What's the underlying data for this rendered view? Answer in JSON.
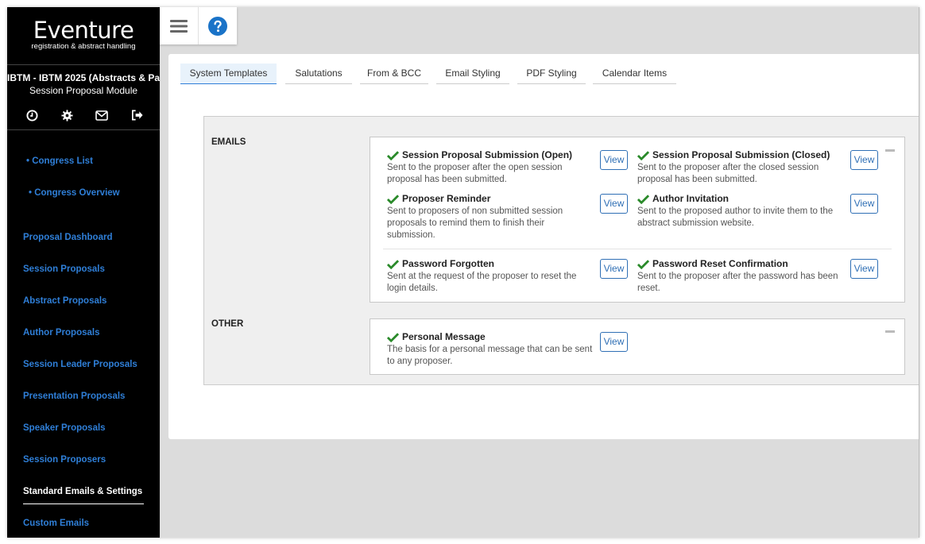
{
  "sidebar": {
    "logo_title": "Eventure",
    "logo_subtitle": "registration & abstract handling",
    "congress_title": "IBTM - IBTM 2025 (Abstracts & Par...",
    "module_title": "Session Proposal Module",
    "icons": [
      "clock-icon",
      "gear-icon",
      "mail-icon",
      "logout-icon"
    ],
    "sub_links": [
      "• Congress List",
      "• Congress Overview"
    ],
    "nav_items": [
      "Proposal Dashboard",
      "Session Proposals",
      "Abstract Proposals",
      "Author Proposals",
      "Session Leader Proposals",
      "Presentation Proposals",
      "Speaker Proposals",
      "Session Proposers",
      "Standard Emails & Settings",
      "Custom Emails"
    ],
    "active_item": "Standard Emails & Settings"
  },
  "toolbar": {
    "menu_icon": "hamburger-icon",
    "help_icon": "help-icon"
  },
  "tabs": [
    "System Templates",
    "Salutations",
    "From & BCC",
    "Email Styling",
    "PDF Styling",
    "Calendar Items"
  ],
  "active_tab": "System Templates",
  "sections": {
    "emails": {
      "label": "EMAILS",
      "templates": [
        {
          "title": "Session Proposal Submission (Open)",
          "desc": "Sent to the proposer after the open session proposal has been submitted.",
          "button": "View"
        },
        {
          "title": "Session Proposal Submission (Closed)",
          "desc": "Sent to the proposer after the closed session proposal has been submitted.",
          "button": "View"
        },
        {
          "title": "Proposer Reminder",
          "desc": "Sent to proposers of non submitted session proposals to remind them to finish their submission.",
          "button": "View"
        },
        {
          "title": "Author Invitation",
          "desc": "Sent to the proposed author to invite them to the abstract submission website.",
          "button": "View"
        },
        {
          "title": "Password Forgotten",
          "desc": "Sent at the request of the proposer to reset the login details.",
          "button": "View"
        },
        {
          "title": "Password Reset Confirmation",
          "desc": "Sent to the proposer after the password has been reset.",
          "button": "View"
        }
      ]
    },
    "other": {
      "label": "OTHER",
      "templates": [
        {
          "title": "Personal Message",
          "desc": "The basis for a personal message that can be sent to any proposer.",
          "button": "View"
        }
      ]
    }
  },
  "colors": {
    "sidebar_bg": "#000000",
    "link_blue": "#2f7fd8",
    "check_green": "#2a8a2a",
    "help_blue": "#1a73c8"
  }
}
